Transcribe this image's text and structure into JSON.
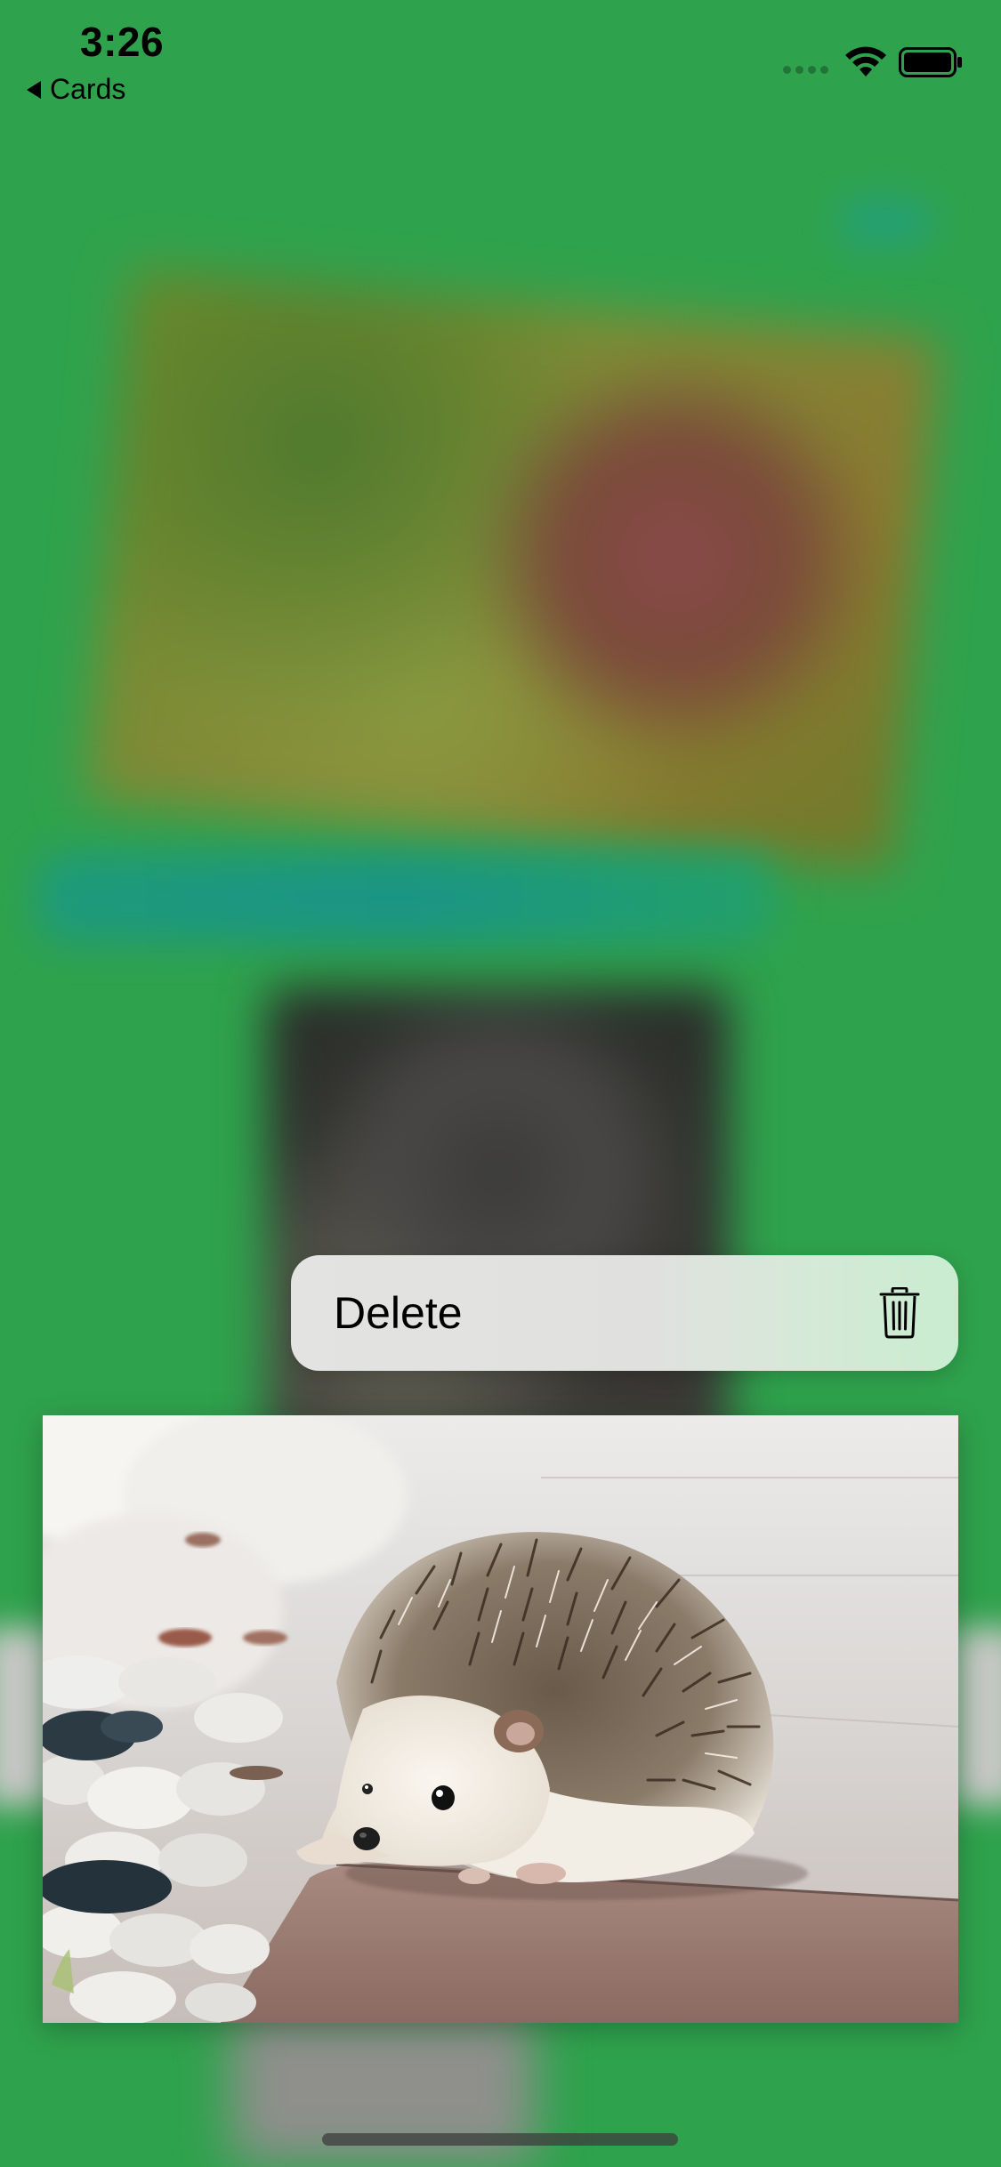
{
  "status_bar": {
    "time": "3:26",
    "wifi": "wifi-icon",
    "battery": "battery-icon"
  },
  "navigation": {
    "back_label": "Cards"
  },
  "context_menu": {
    "items": [
      {
        "label": "Delete",
        "icon": "trash-icon"
      }
    ]
  },
  "preview": {
    "subject": "hedgehog-photo"
  },
  "colors": {
    "background": "#2fa24d"
  }
}
